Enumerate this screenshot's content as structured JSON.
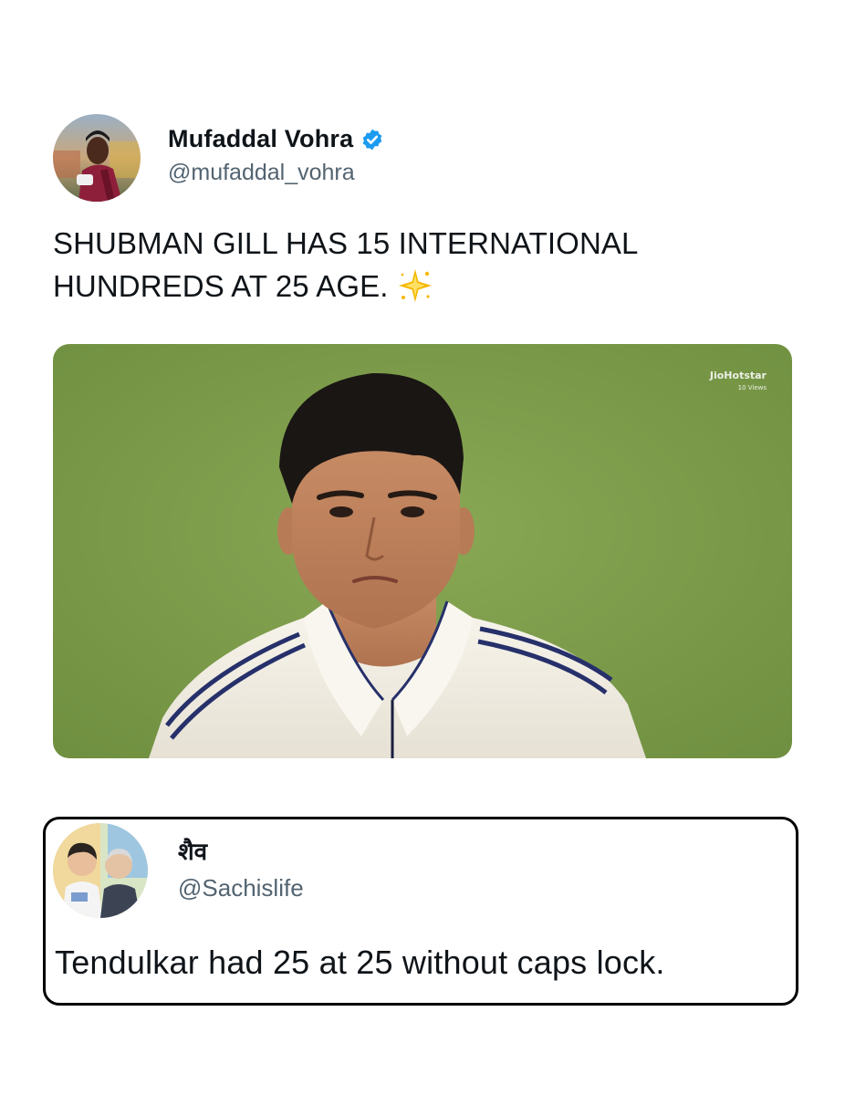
{
  "tweet": {
    "display_name": "Mufaddal Vohra",
    "handle": "@mufaddal_vohra",
    "verified": true,
    "text": "SHUBMAN GILL HAS 15 INTERNATIONAL HUNDREDS AT 25 AGE.",
    "emoji_icon": "sparkle-icon",
    "media": {
      "watermark_brand": "JioHotstar",
      "watermark_sub": "10 Views"
    }
  },
  "reply": {
    "display_name": "शैव",
    "handle": "@Sachislife",
    "text": "Tendulkar had 25 at 25 without caps lock."
  },
  "colors": {
    "verified_blue": "#1d9bf0",
    "handle_gray": "#536471",
    "pitch_green": "#7a9a48",
    "jersey_navy": "#26306a"
  }
}
